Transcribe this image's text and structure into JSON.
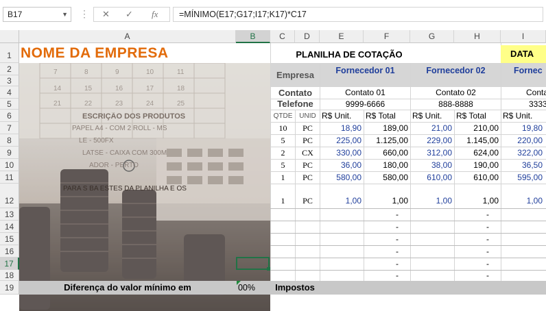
{
  "formula_bar": {
    "name_box": "B17",
    "formula": "=MÍNIMO(E17;G17;I17;K17)*C17",
    "cancel_icon": "✕",
    "enter_icon": "✓",
    "fx_label": "fx"
  },
  "columns": [
    "A",
    "B",
    "C",
    "D",
    "E",
    "F",
    "G",
    "H",
    "I"
  ],
  "rows": [
    "1",
    "2",
    "3",
    "4",
    "5",
    "6",
    "7",
    "8",
    "9",
    "10",
    "11",
    "12",
    "13",
    "14",
    "15",
    "16",
    "17",
    "18",
    "19"
  ],
  "sheet": {
    "company_name": "NOME DA EMPRESA",
    "title": "PLANILHA DE COTAÇÃO",
    "date_label": "DATA",
    "empresa_label": "Empresa",
    "contato_label": "Contato",
    "telefone_label": "Telefone",
    "suppliers": [
      {
        "name": "Fornecedor 01",
        "contact": "Contato 01",
        "phone": "9999-6666"
      },
      {
        "name": "Fornecedor 02",
        "contact": "Contato 02",
        "phone": "888-8888"
      },
      {
        "name": "Fornec",
        "contact": "Conta",
        "phone": "3333"
      }
    ],
    "qtde_label": "QTDE",
    "unid_label": "UNID",
    "unit_label": "R$ Unit.",
    "total_label": "R$ Total",
    "items": [
      {
        "qtde": "10",
        "unid": "PC",
        "u1": "18,90",
        "t1": "189,00",
        "u2": "21,00",
        "t2": "210,00",
        "u3": "19,80"
      },
      {
        "qtde": "5",
        "unid": "PC",
        "u1": "225,00",
        "t1": "1.125,00",
        "u2": "229,00",
        "t2": "1.145,00",
        "u3": "220,00"
      },
      {
        "qtde": "2",
        "unid": "CX",
        "u1": "330,00",
        "t1": "660,00",
        "u2": "312,00",
        "t2": "624,00",
        "u3": "322,00"
      },
      {
        "qtde": "5",
        "unid": "PC",
        "u1": "36,00",
        "t1": "180,00",
        "u2": "38,00",
        "t2": "190,00",
        "u3": "36,50"
      },
      {
        "qtde": "1",
        "unid": "PC",
        "u1": "580,00",
        "t1": "580,00",
        "u2": "610,00",
        "t2": "610,00",
        "u3": "595,00"
      },
      {
        "qtde": "1",
        "unid": "PC",
        "u1": "1,00",
        "t1": "1,00",
        "u2": "1,00",
        "t2": "1,00",
        "u3": "1,00"
      }
    ],
    "dash": "-",
    "photo_text": {
      "l1": "ESCRIÇÃO DOS PRODUTOS",
      "l2": "PAPEL A4 - COM 2 ROLL - MS",
      "l3": "LE - 500FX",
      "l4": "LATSE - CAIXA COM 300M",
      "l5": "ADOR - PERTO",
      "l6": "PARA S BA   ESTES  DA  PLANILHA  E  OS"
    },
    "footer_label": "Diferença do valor mínimo em",
    "footer_pct": "00%",
    "impostos_label": "Impostos"
  }
}
